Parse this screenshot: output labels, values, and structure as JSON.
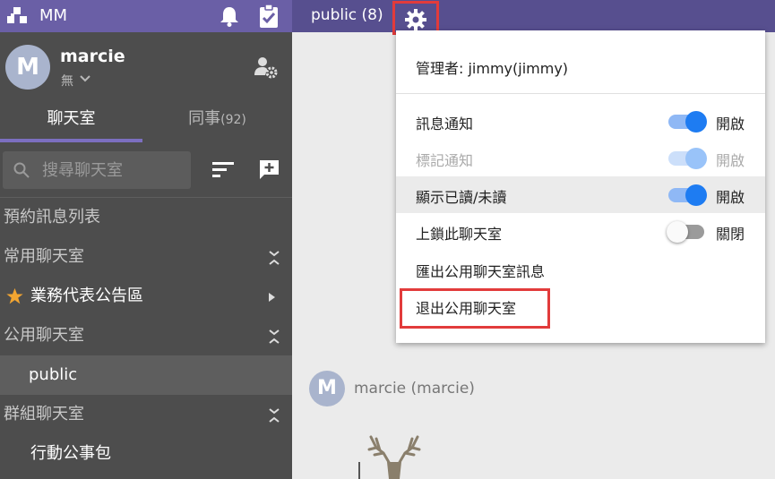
{
  "app": {
    "name": "MM"
  },
  "user": {
    "initial": "M",
    "name": "marcie",
    "status": "無"
  },
  "tabs": {
    "rooms": "聊天室",
    "colleagues": "同事",
    "colleagues_count": "(92)"
  },
  "search": {
    "placeholder": "搜尋聊天室"
  },
  "sidebar": {
    "scheduled": "預約訊息列表",
    "favorites_header": "常用聊天室",
    "favorite_item": "業務代表公告區",
    "public_header": "公用聊天室",
    "public_item": "public",
    "group_header": "群組聊天室",
    "group_item": "行動公事包"
  },
  "header": {
    "channel_title": "public (8)"
  },
  "menu": {
    "admin": "管理者: jimmy(jimmy)",
    "items": [
      {
        "label": "訊息通知",
        "state": "開啟",
        "on": true,
        "disabled": false
      },
      {
        "label": "標記通知",
        "state": "開啟",
        "on": true,
        "disabled": true
      },
      {
        "label": "顯示已讀/未讀",
        "state": "開啟",
        "on": true,
        "disabled": false
      },
      {
        "label": "上鎖此聊天室",
        "state": "關閉",
        "on": false,
        "disabled": false
      }
    ],
    "export": "匯出公用聊天室訊息",
    "leave": "退出公用聊天室"
  },
  "message": {
    "author_initial": "M",
    "author": "marcie (marcie)"
  },
  "colors": {
    "sidebar": "#4d4d4d",
    "topbar": "#6a5fa6",
    "header": "#574f8f",
    "toggle_on": "#1e7cf2",
    "highlight": "#e23b3b"
  },
  "icons": [
    "app-logo-icon",
    "bell-icon",
    "clipboard-check-icon",
    "user-settings-icon",
    "search-icon",
    "sort-icon",
    "new-chat-icon",
    "star-icon",
    "collapse-icon",
    "gear-icon"
  ]
}
